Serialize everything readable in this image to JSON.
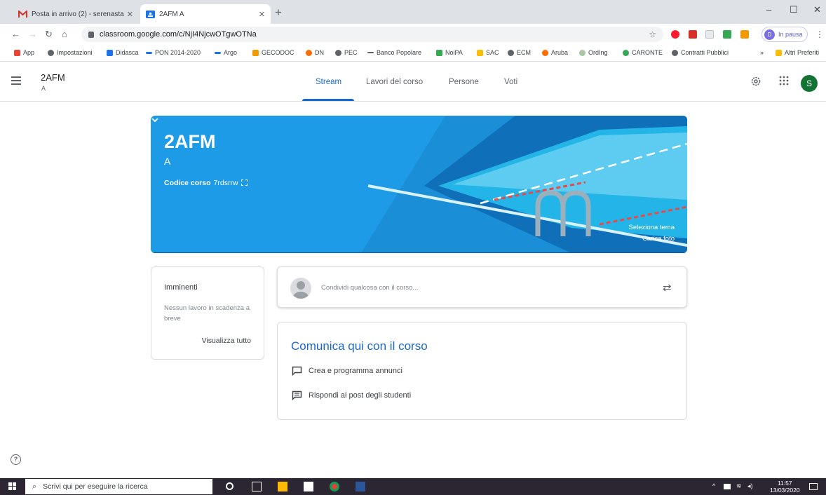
{
  "browser": {
    "tabs": [
      {
        "title": "Posta in arrivo (2) - serenastagni",
        "close": "✕",
        "favicon": "gmail-icon"
      },
      {
        "title": "2AFM A",
        "close": "✕",
        "favicon": "classroom-icon"
      }
    ],
    "new_tab": "+",
    "window_controls": {
      "minimize": "–",
      "maximize": "☐",
      "close": "✕"
    },
    "url": "classroom.google.com/c/NjI4NjcwOTgwOTNa",
    "profile_initial": "D",
    "profile_status": "In pausa",
    "bookmarks": [
      "App",
      "Impostazioni",
      "Didasca",
      "PON 2014-2020",
      "Argo",
      "GECODOC",
      "DN",
      "PEC",
      "Banco Popolare",
      "NoiPA",
      "SAC",
      "ECM",
      "Aruba",
      "OrdIng",
      "CARONTE",
      "Contratti Pubblici"
    ],
    "bookmarks_more": "»",
    "other_bookmarks": "Altri Preferiti"
  },
  "header": {
    "course_title": "2AFM",
    "course_section": "A",
    "tabs": [
      "Stream",
      "Lavori del corso",
      "Persone",
      "Voti"
    ],
    "active_tab": "Stream",
    "avatar_initial": "S"
  },
  "banner": {
    "title": "2AFM",
    "section": "A",
    "code_label": "Codice corso",
    "code_value": "7rdsrrw",
    "select_theme": "Seleziona tema",
    "upload_photo": "Carica foto"
  },
  "upcoming": {
    "title": "Imminenti",
    "empty_text": "Nessun lavoro in scadenza a breve",
    "view_all": "Visualizza tutto"
  },
  "share": {
    "placeholder": "Condividi qualcosa con il corso..."
  },
  "communicate": {
    "title": "Comunica qui con il corso",
    "items": [
      "Crea e programma annunci",
      "Rispondi ai post degli studenti"
    ]
  },
  "taskbar": {
    "search_placeholder": "Scrivi qui per eseguire la ricerca",
    "time": "11:57",
    "date": "13/03/2020"
  },
  "colors": {
    "accent": "#1967d2",
    "banner": "#1e9be6",
    "avatar": "#137333"
  }
}
